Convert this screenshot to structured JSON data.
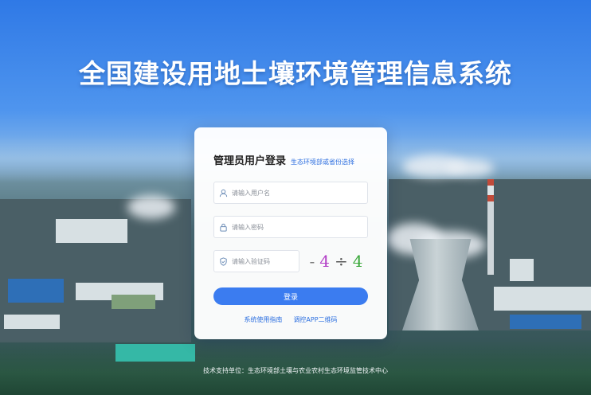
{
  "page_title": "全国建设用地土壤环境管理信息系统",
  "login": {
    "title": "管理员用户登录",
    "switch_link": "生态环境部或省份选择",
    "username_placeholder": "请输入用户名",
    "password_placeholder": "请输入密码",
    "captcha_placeholder": "请输入验证码",
    "captcha_glyphs": [
      "-",
      "4",
      "÷",
      "4"
    ],
    "captcha_colors": [
      "#7a7a7a",
      "#b33fc7",
      "#555555",
      "#3aa83a"
    ],
    "submit_label": "登录",
    "guide_link": "系统使用指南",
    "app_qr_link": "调控APP二维码"
  },
  "footer": {
    "support_text": "技术支持单位：生态环境部土壤与农业农村生态环境监管技术中心"
  },
  "colors": {
    "accent": "#3b7cf0",
    "link": "#2c6fe0"
  },
  "icons": {
    "username": "user-icon",
    "password": "lock-icon",
    "captcha": "shield-icon"
  }
}
